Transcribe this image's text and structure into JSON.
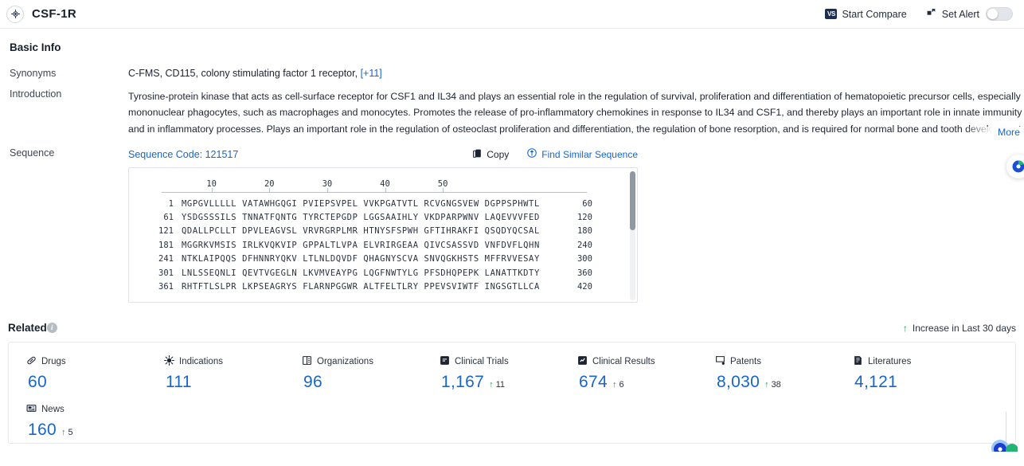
{
  "header": {
    "title": "CSF-1R",
    "target_icon": "target-icon",
    "start_compare": "Start Compare",
    "compare_badge": "VS",
    "set_alert": "Set Alert",
    "alert_toggle_state": "off"
  },
  "basic_info": {
    "section_title": "Basic Info",
    "synonyms_label": "Synonyms",
    "synonyms_value": "C-FMS,  CD115,  colony stimulating factor 1 receptor,",
    "synonyms_more": "[+11]",
    "introduction_label": "Introduction",
    "introduction_text": "Tyrosine-protein kinase that acts as cell-surface receptor for CSF1 and IL34 and plays an essential role in the regulation of survival, proliferation and differentiation of hematopoietic precursor cells, especially mononuclear phagocytes, such as macrophages and monocytes. Promotes the release of pro-inflammatory chemokines in response to IL34 and CSF1, and thereby plays an important role in innate immunity and in inflammatory processes. Plays an important role in the regulation of osteoclast proliferation and differentiation, the regulation of bone resorption, and is required for normal bone and tooth development. Required for normal male and",
    "more_label": "More"
  },
  "sequence": {
    "label": "Sequence",
    "code_label": "Sequence Code: 121517",
    "copy_label": "Copy",
    "find_similar_label": "Find Similar Sequence",
    "ruler_ticks": [
      10,
      20,
      30,
      40,
      50
    ],
    "rows": [
      {
        "start": "1",
        "chunks": "MGPGVLLLLL VATAWHGQGI PVIEPSVPEL VVKPGATVTL RCVGNGSVEW DGPPSPHWTL",
        "end": "60"
      },
      {
        "start": "61",
        "chunks": "YSDGSSSILS TNNATFQNTG TYRCTEPGDP LGGSAAIHLY VKDPARPWNV LAQEVVVFED",
        "end": "120"
      },
      {
        "start": "121",
        "chunks": "QDALLPCLLT DPVLEAGVSL VRVRGRPLMR HTNYSFSPWH GFTIHRAKFI QSQDYQCSAL",
        "end": "180"
      },
      {
        "start": "181",
        "chunks": "MGGRKVMSIS IRLKVQKVIP GPPALTLVPA ELVRIRGEAA QIVCSASSVD VNFDVFLQHN",
        "end": "240"
      },
      {
        "start": "241",
        "chunks": "NTKLAIPQQS DFHNNRYQKV LTLNLDQVDF QHAGNYSCVA SNVQGKHSTS MFFRVVESAY",
        "end": "300"
      },
      {
        "start": "301",
        "chunks": "LNLSSEQNLI QEVTVGEGLN LKVMVEAYPG LQGFNWTYLG PFSDHQPEPK LANATTKDTY",
        "end": "360"
      },
      {
        "start": "361",
        "chunks": "RHTFTLSLPR LKPSEAGRYS FLARNPGGWR ALTFELTLRY PPEVSVIWTF INGSGTLLCA",
        "end": "420"
      }
    ]
  },
  "related": {
    "section_title": "Related",
    "legend_text": "Increase in Last 30 days",
    "legend_arrow": "↑",
    "stats": [
      {
        "icon": "pill-icon",
        "label": "Drugs",
        "value": "60",
        "delta": ""
      },
      {
        "icon": "virus-icon",
        "label": "Indications",
        "value": "111",
        "delta": ""
      },
      {
        "icon": "organization-icon",
        "label": "Organizations",
        "value": "96",
        "delta": ""
      },
      {
        "icon": "clinical-trials-icon",
        "label": "Clinical Trials",
        "value": "1,167",
        "delta": "11"
      },
      {
        "icon": "clinical-results-icon",
        "label": "Clinical Results",
        "value": "674",
        "delta": "6"
      },
      {
        "icon": "patents-icon",
        "label": "Patents",
        "value": "8,030",
        "delta": "38"
      },
      {
        "icon": "literatures-icon",
        "label": "Literatures",
        "value": "4,121",
        "delta": ""
      },
      {
        "icon": "news-icon",
        "label": "News",
        "value": "160",
        "delta": "5"
      }
    ]
  },
  "colors": {
    "accent_blue": "#1766cc",
    "value_blue": "#1766cc",
    "increase_green": "#219653",
    "text_dark": "#1c2331",
    "border": "#e6e8eb"
  }
}
